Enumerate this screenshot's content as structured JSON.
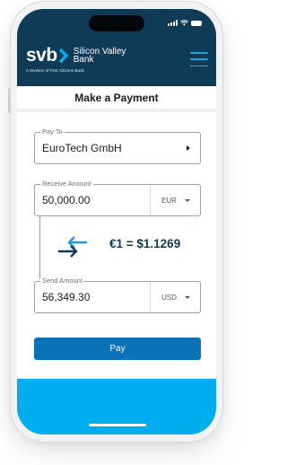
{
  "brand": {
    "logo_text": "svb",
    "name_line1": "Silicon Valley",
    "name_line2": "Bank",
    "subtitle": "A Division of First Citizens Bank"
  },
  "page": {
    "title": "Make a Payment"
  },
  "pay_to": {
    "label": "Pay To",
    "value": "EuroTech GmbH"
  },
  "receive_amount": {
    "label": "Receive Amount",
    "value": "50,000.00",
    "currency": "EUR"
  },
  "exchange": {
    "rate": "€1 = $1.1269"
  },
  "send_amount": {
    "label": "Send Amount",
    "value": "56,349.30",
    "currency": "USD"
  },
  "actions": {
    "pay_label": "Pay"
  },
  "colors": {
    "header_bg": "#0f3b57",
    "accent_blue": "#0a73b7",
    "bottom_cyan": "#00aeef",
    "hamburger": "#1fa4d6"
  },
  "icons": {
    "menu": "hamburger-icon",
    "swap": "swap-arrows-icon",
    "dropdown": "caret-down-icon",
    "chevron": "caret-right-icon"
  }
}
